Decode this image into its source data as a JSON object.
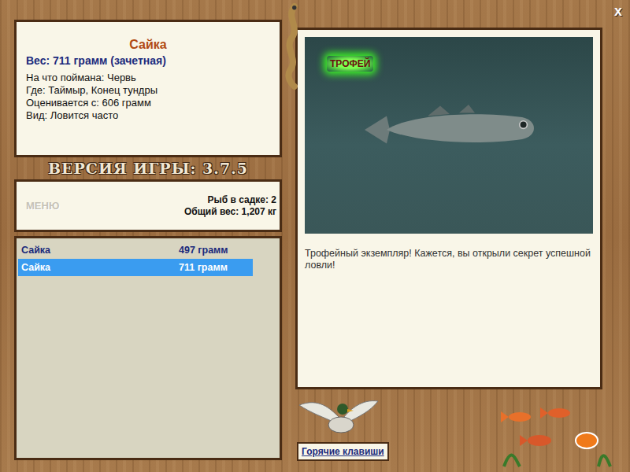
{
  "fish": {
    "name": "Сайка",
    "weight": "Вес: 711 грамм (зачетная)",
    "details": [
      "На что поймана: Червь",
      "Где: Таймыр, Конец тундры",
      "Оценивается с: 606 грамм",
      "Вид: Ловится часто"
    ]
  },
  "version": "ВЕРСИЯ ИГРЫ: 3.7.5",
  "menu": "МЕНЮ",
  "keepnet": {
    "count": "Рыб в садке: 2",
    "total": "Общий вес: 1,207 кг"
  },
  "catch_list": [
    {
      "name": "Сайка",
      "weight": "497 грамм",
      "selected": false
    },
    {
      "name": "Сайка",
      "weight": "711 грамм",
      "selected": true
    }
  ],
  "photo": {
    "badge": "ТРОФЕЙ"
  },
  "description": "Трофейный экземпляр! Кажется, вы открыли секрет успешной ловли!",
  "hotkeys_button": "Горячие клавиши",
  "close_button": "x"
}
